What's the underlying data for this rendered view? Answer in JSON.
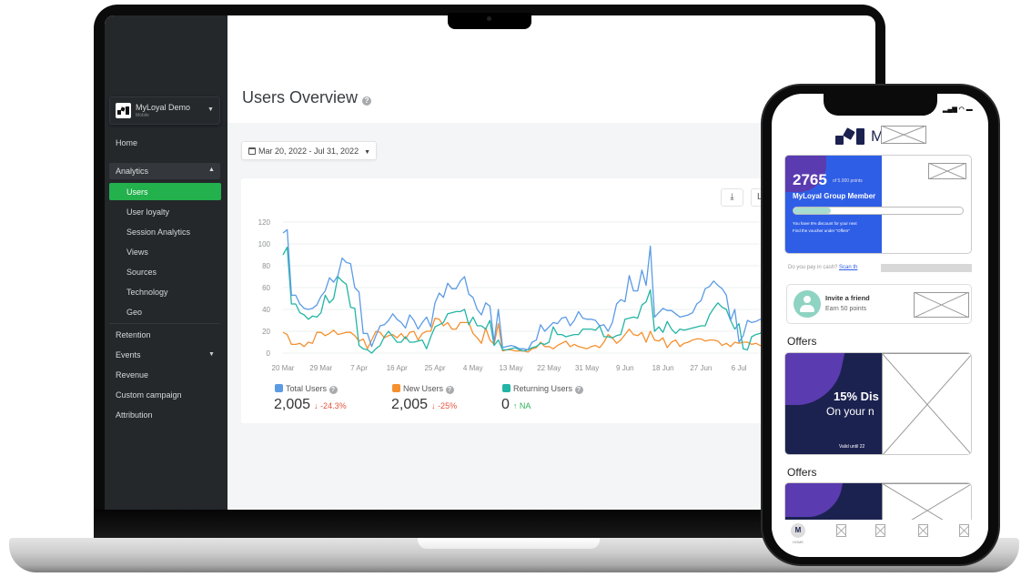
{
  "sidebar": {
    "account_name": "MyLoyal Demo",
    "account_sub": "Mobile",
    "items": [
      {
        "label": "Home"
      },
      {
        "label": "Analytics"
      },
      {
        "label": "Users"
      },
      {
        "label": "User loyalty"
      },
      {
        "label": "Session Analytics"
      },
      {
        "label": "Views"
      },
      {
        "label": "Sources"
      },
      {
        "label": "Technology"
      },
      {
        "label": "Geo"
      },
      {
        "label": "Retention"
      },
      {
        "label": "Events"
      },
      {
        "label": "Revenue"
      },
      {
        "label": "Custom campaign"
      },
      {
        "label": "Attribution"
      }
    ],
    "active": "Users",
    "active_color": "#22b14c"
  },
  "header": {
    "title": "Users Overview",
    "help": "?"
  },
  "date_range": "Mar 20, 2022 - Jul 31, 2022",
  "toolbar": {
    "download_icon": "download-icon",
    "partial_button": "L"
  },
  "legend": [
    {
      "name": "Total Users",
      "value": "2,005",
      "delta": "-24.3%",
      "trend": "down",
      "color": "#5b9be6",
      "delta_color": "#e5533d"
    },
    {
      "name": "New Users",
      "value": "2,005",
      "delta": "-25%",
      "trend": "down",
      "color": "#f5902f",
      "delta_color": "#e5533d"
    },
    {
      "name": "Returning Users",
      "value": "0",
      "delta": "NA",
      "trend": "up",
      "color": "#22b5a5",
      "delta_color": "#2fb45a"
    }
  ],
  "chart_data": {
    "type": "line",
    "ylim": [
      0,
      120
    ],
    "y_ticks": [
      0,
      20,
      40,
      60,
      80,
      100,
      120
    ],
    "x_tick_labels": [
      "20 Mar",
      "29 Mar",
      "7 Apr",
      "16 Apr",
      "25 Apr",
      "4 May",
      "13 May",
      "22 May",
      "31 May",
      "9 Jun",
      "18 Jun",
      "27 Jun",
      "6 Jul"
    ],
    "grid": true,
    "dates": [
      "2022-03-20",
      "2022-03-21",
      "2022-03-22",
      "2022-03-23",
      "2022-03-24",
      "2022-03-25",
      "2022-03-26",
      "2022-03-27",
      "2022-03-28",
      "2022-03-29",
      "2022-03-30",
      "2022-03-31",
      "2022-04-01",
      "2022-04-02",
      "2022-04-03",
      "2022-04-04",
      "2022-04-05",
      "2022-04-06",
      "2022-04-07",
      "2022-04-08",
      "2022-04-09",
      "2022-04-10",
      "2022-04-11",
      "2022-04-12",
      "2022-04-13",
      "2022-04-14",
      "2022-04-15",
      "2022-04-16",
      "2022-04-17",
      "2022-04-18",
      "2022-04-19",
      "2022-04-20",
      "2022-04-21",
      "2022-04-22",
      "2022-04-23",
      "2022-04-24",
      "2022-04-25",
      "2022-04-26",
      "2022-04-27",
      "2022-04-28",
      "2022-04-29",
      "2022-04-30",
      "2022-05-01",
      "2022-05-02",
      "2022-05-03",
      "2022-05-04",
      "2022-05-05",
      "2022-05-06",
      "2022-05-07",
      "2022-05-08",
      "2022-05-09",
      "2022-05-10",
      "2022-05-11",
      "2022-05-12",
      "2022-05-13",
      "2022-05-14",
      "2022-05-15",
      "2022-05-16",
      "2022-05-17",
      "2022-05-18",
      "2022-05-19",
      "2022-05-20",
      "2022-05-21",
      "2022-05-22",
      "2022-05-23",
      "2022-05-24",
      "2022-05-25",
      "2022-05-26",
      "2022-05-27",
      "2022-05-28",
      "2022-05-29",
      "2022-05-30",
      "2022-05-31",
      "2022-06-01",
      "2022-06-02",
      "2022-06-03",
      "2022-06-04",
      "2022-06-05",
      "2022-06-06",
      "2022-06-07",
      "2022-06-08",
      "2022-06-09",
      "2022-06-10",
      "2022-06-11",
      "2022-06-12",
      "2022-06-13",
      "2022-06-14",
      "2022-06-15",
      "2022-06-16",
      "2022-06-17",
      "2022-06-18",
      "2022-06-19",
      "2022-06-20",
      "2022-06-21",
      "2022-06-22",
      "2022-06-23",
      "2022-06-24",
      "2022-06-25",
      "2022-06-26",
      "2022-06-27",
      "2022-06-28",
      "2022-06-29",
      "2022-06-30",
      "2022-07-01",
      "2022-07-02",
      "2022-07-03",
      "2022-07-04",
      "2022-07-05",
      "2022-07-06",
      "2022-07-07",
      "2022-07-08",
      "2022-07-09",
      "2022-07-10",
      "2022-07-11",
      "2022-07-12"
    ],
    "series": [
      {
        "name": "Total Users",
        "color": "#5b9be6",
        "values": [
          110,
          113,
          53,
          53,
          45,
          41,
          40,
          41,
          44,
          52,
          57,
          69,
          65,
          71,
          87,
          83,
          82,
          60,
          56,
          18,
          18,
          6,
          16,
          25,
          26,
          30,
          36,
          31,
          28,
          23,
          35,
          30,
          22,
          28,
          33,
          24,
          46,
          55,
          51,
          64,
          59,
          59,
          66,
          70,
          54,
          51,
          40,
          35,
          46,
          43,
          10,
          40,
          5,
          6,
          7,
          6,
          4,
          4,
          3,
          10,
          12,
          26,
          20,
          24,
          28,
          27,
          32,
          33,
          25,
          30,
          38,
          32,
          31,
          31,
          30,
          25,
          26,
          20,
          28,
          45,
          49,
          47,
          71,
          57,
          57,
          76,
          62,
          98,
          33,
          37,
          41,
          39,
          39,
          36,
          33,
          34,
          35,
          37,
          45,
          48,
          59,
          61,
          66,
          62,
          59,
          53,
          30,
          40,
          10,
          16,
          30,
          28,
          29,
          31,
          31
        ]
      },
      {
        "name": "New Users",
        "color": "#f5902f",
        "values": [
          19,
          17,
          8,
          8,
          9,
          6,
          10,
          9,
          19,
          19,
          16,
          18,
          21,
          17,
          18,
          19,
          19,
          16,
          11,
          13,
          4,
          12,
          20,
          19,
          14,
          16,
          17,
          14,
          18,
          13,
          19,
          20,
          12,
          18,
          20,
          20,
          32,
          31,
          25,
          28,
          22,
          22,
          28,
          28,
          28,
          18,
          14,
          9,
          23,
          12,
          8,
          27,
          2,
          3,
          3,
          2,
          2,
          2,
          1,
          4,
          5,
          10,
          6,
          6,
          4,
          7,
          9,
          11,
          6,
          8,
          6,
          5,
          4,
          6,
          7,
          5,
          10,
          17,
          14,
          9,
          12,
          17,
          22,
          17,
          16,
          19,
          10,
          20,
          12,
          11,
          14,
          5,
          10,
          12,
          6,
          9,
          10,
          12,
          13,
          13,
          11,
          12,
          12,
          11,
          7,
          9,
          6,
          10,
          9,
          10,
          10,
          8,
          9,
          7,
          7
        ]
      },
      {
        "name": "Returning Users",
        "color": "#22b5a5",
        "values": [
          90,
          97,
          45,
          45,
          37,
          35,
          31,
          34,
          33,
          37,
          53,
          46,
          50,
          70,
          66,
          63,
          42,
          41,
          7,
          4,
          3,
          0,
          4,
          7,
          15,
          20,
          15,
          10,
          10,
          15,
          10,
          10,
          11,
          12,
          4,
          15,
          24,
          26,
          28,
          36,
          37,
          38,
          38,
          40,
          26,
          33,
          25,
          25,
          22,
          30,
          7,
          12,
          3,
          3,
          4,
          5,
          3,
          2,
          3,
          5,
          6,
          9,
          8,
          10,
          24,
          17,
          17,
          15,
          16,
          17,
          17,
          22,
          22,
          22,
          21,
          25,
          15,
          15,
          14,
          16,
          17,
          31,
          32,
          33,
          32,
          44,
          47,
          58,
          20,
          24,
          19,
          29,
          22,
          18,
          22,
          21,
          22,
          23,
          24,
          25,
          25,
          35,
          41,
          46,
          42,
          40,
          30,
          22,
          27,
          4,
          3,
          15,
          17,
          18,
          22
        ]
      }
    ]
  },
  "phone": {
    "logo_letter": "M",
    "points": "2765",
    "points_total": "of 5.000 points",
    "tier": "MyLoyal Group Member",
    "progress_fraction": 0.22,
    "promo_line1": "You have 5% discount for your next",
    "promo_line2": "Find the voucher under \"Offers\"",
    "cash_text": "Do you pay in cash?",
    "cash_link": "Scan th",
    "invite_title": "Invite a friend",
    "invite_sub": "Earn 50 points",
    "offers_heading": "Offers",
    "offer_title": "15% Dis",
    "offer_sub": "On your n",
    "offer_valid": "Valid until 22",
    "offers_heading2": "Offers",
    "nav": [
      {
        "label": "HOME",
        "icon": "home-logo-icon"
      },
      {
        "label": "",
        "icon": "card-icon"
      },
      {
        "label": "",
        "icon": "image-placeholder-icon"
      },
      {
        "label": "",
        "icon": "image-placeholder-icon"
      },
      {
        "label": "",
        "icon": "image-placeholder-icon"
      }
    ],
    "card_blue": "#2f5ee6",
    "card_purple": "#5b3bb0",
    "offer_navy": "#1b2250",
    "accent_teal": "#a8ddd0"
  }
}
